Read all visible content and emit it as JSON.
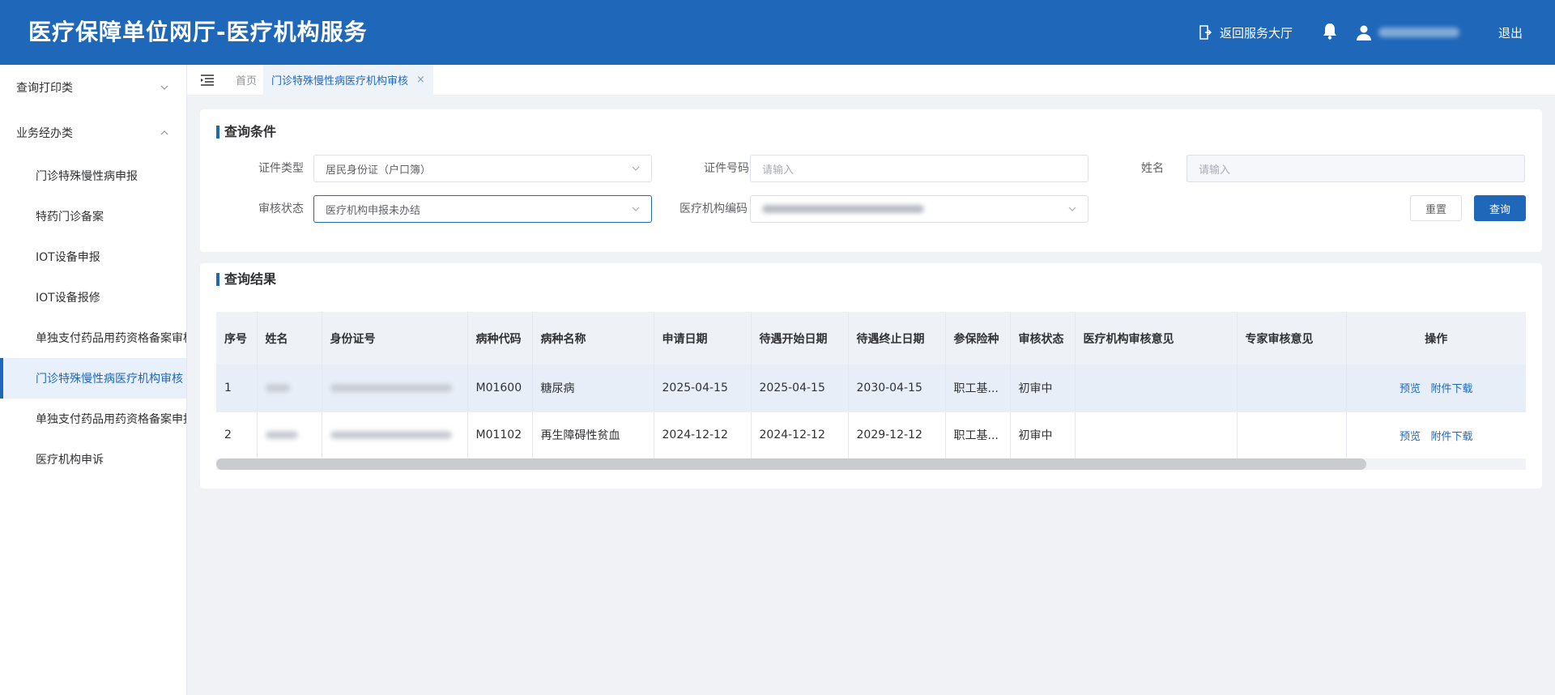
{
  "header": {
    "title": "医疗保障单位网厅-医疗机构服务",
    "back_label": "返回服务大厅",
    "logout_label": "退出"
  },
  "sidebar": {
    "groups": [
      {
        "label": "查询打印类"
      },
      {
        "label": "业务经办类"
      }
    ],
    "items": [
      {
        "label": "门诊特殊慢性病申报"
      },
      {
        "label": "特药门诊备案"
      },
      {
        "label": "IOT设备申报"
      },
      {
        "label": "IOT设备报修"
      },
      {
        "label": "单独支付药品用药资格备案审核"
      },
      {
        "label": "门诊特殊慢性病医疗机构审核"
      },
      {
        "label": "单独支付药品用药资格备案申报"
      },
      {
        "label": "医疗机构申诉"
      }
    ],
    "active_index": 5
  },
  "tabs": {
    "home": "首页",
    "active": "门诊特殊慢性病医疗机构审核",
    "close": "×"
  },
  "query": {
    "title": "查询条件",
    "cert_type_label": "证件类型",
    "cert_type_value": "居民身份证（户口簿）",
    "cert_no_label": "证件号码",
    "cert_no_placeholder": "请输入",
    "name_label": "姓名",
    "name_placeholder": "请输入",
    "status_label": "审核状态",
    "status_value": "医疗机构申报未办结",
    "org_code_label": "医疗机构编码",
    "reset_label": "重置",
    "query_label": "查询"
  },
  "results": {
    "title": "查询结果",
    "columns": [
      "序号",
      "姓名",
      "身份证号",
      "病种代码",
      "病种名称",
      "申请日期",
      "待遇开始日期",
      "待遇终止日期",
      "参保险种",
      "审核状态",
      "医疗机构审核意见",
      "专家审核意见",
      "操作"
    ],
    "rows": [
      {
        "no": "1",
        "code": "M01600",
        "disease": "糖尿病",
        "apply_date": "2025-04-15",
        "start_date": "2025-04-15",
        "end_date": "2030-04-15",
        "insurance": "职工基...",
        "status": "初审中",
        "org_opinion": "",
        "expert_opinion": "",
        "preview": "预览",
        "download": "附件下载"
      },
      {
        "no": "2",
        "code": "M01102",
        "disease": "再生障碍性贫血",
        "apply_date": "2024-12-12",
        "start_date": "2024-12-12",
        "end_date": "2029-12-12",
        "insurance": "职工基...",
        "status": "初审中",
        "org_opinion": "",
        "expert_opinion": "",
        "preview": "预览",
        "download": "附件下载"
      }
    ]
  },
  "colors": {
    "primary": "#1f67b9",
    "header_bg": "#1f67b9"
  }
}
